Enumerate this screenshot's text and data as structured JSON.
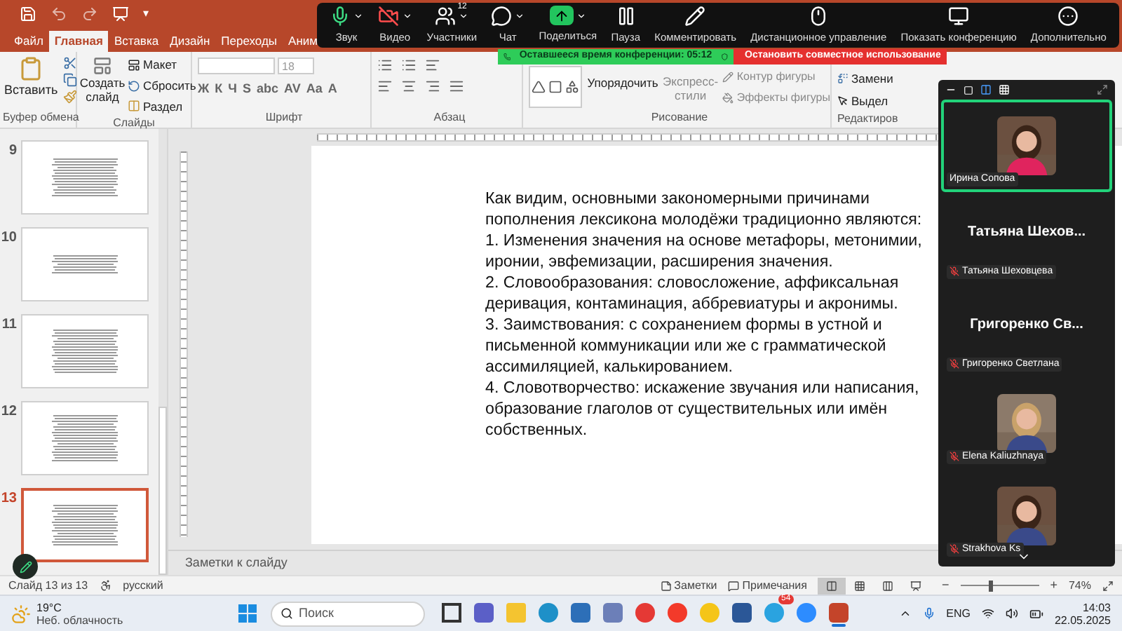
{
  "quick_access": {
    "dropdown": "▾"
  },
  "tabs": [
    {
      "label": "Файл",
      "selected": false
    },
    {
      "label": "Главная",
      "selected": true
    },
    {
      "label": "Вставка",
      "selected": false
    },
    {
      "label": "Дизайн",
      "selected": false
    },
    {
      "label": "Переходы",
      "selected": false
    },
    {
      "label": "Аним",
      "selected": false
    }
  ],
  "ribbon": {
    "clipboard": {
      "paste": "Вставить",
      "label": "Буфер обмена"
    },
    "slides": {
      "new_slide": "Создать слайд",
      "layout": "Макет",
      "reset": "Сбросить",
      "section": "Раздел",
      "label": "Слайды"
    },
    "font": {
      "size": "18",
      "buttons": [
        "Ж",
        "К",
        "Ч",
        "S",
        "abc",
        "AV",
        "Aa",
        "A"
      ],
      "label": "Шрифт"
    },
    "paragraph": {
      "label": "Абзац"
    },
    "drawing": {
      "arrange": "Упорядочить",
      "styles": "Экспресс-стили",
      "outline": "Контур фигуры",
      "effects": "Эффекты фигуры",
      "label": "Рисование"
    },
    "editing": {
      "replace": "Замени",
      "select": "Выдел",
      "label": "Редактиров"
    }
  },
  "thumbnails": [
    {
      "number": "9",
      "selected": false
    },
    {
      "number": "10",
      "selected": false
    },
    {
      "number": "11",
      "selected": false
    },
    {
      "number": "12",
      "selected": false
    },
    {
      "number": "13",
      "selected": true
    }
  ],
  "slide": {
    "paragraphs": [
      "Как видим, основными закономерными причинами пополнения лексикона молодёжи традиционно являются:",
      "1. Изменения значения на основе метафоры, метонимии, иронии, эвфемизации, расширения значения.",
      "2. Словообразования: словосложение, аффиксальная деривация, контаминация, аббревиатуры и акронимы.",
      "3. Заимствования: с сохранением формы в устной и письменной коммуникации или же с грамматической ассимиляцией, калькированием.",
      "4. Словотворчество: искажение звучания или написания, образование глаголов от существительных или имён собственных."
    ]
  },
  "notes": {
    "placeholder": "Заметки к слайду"
  },
  "status_bar": {
    "slide": "Слайд 13 из 13",
    "language": "русский",
    "notes": "Заметки",
    "comments": "Примечания",
    "views": [
      {
        "selected": true
      },
      {
        "selected": false
      },
      {
        "selected": false
      },
      {
        "selected": false
      }
    ],
    "zoom_minus": "−",
    "zoom_plus": "+",
    "zoom": {
      "level": 0.38
    },
    "zoom_percent": "74%"
  },
  "meeting_toolbar": [
    {
      "kind": "mic",
      "label": "Звук",
      "caret": true
    },
    {
      "kind": "video",
      "label": "Видео",
      "caret": true
    },
    {
      "kind": "participants",
      "label": "Участники",
      "badge": "12",
      "caret": true
    },
    {
      "kind": "chat",
      "label": "Чат",
      "caret": true
    },
    {
      "kind": "share",
      "label": "Поделиться",
      "caret": true
    },
    {
      "kind": "pause",
      "label": "Пауза",
      "caret": false
    },
    {
      "kind": "annotate",
      "label": "Комментировать",
      "caret": false
    },
    {
      "kind": "remote",
      "label": "Дистанционное управление",
      "caret": false
    },
    {
      "kind": "view",
      "label": "Показать конференцию",
      "caret": false
    },
    {
      "kind": "more",
      "label": "Дополнительно",
      "caret": false
    }
  ],
  "meeting_banner": {
    "timer": "Оставшееся время конференции: 05:12",
    "stop": "Остановить совместное использование"
  },
  "participants": [
    {
      "kind": "video",
      "name": "Ирина Сопова",
      "muted": false,
      "active": true
    },
    {
      "kind": "name",
      "title": "Татьяна Шехов...",
      "name": "Татьяна Шеховцева",
      "muted": true,
      "active": false
    },
    {
      "kind": "name",
      "title": "Григоренко Св...",
      "name": "Григоренко Светлана",
      "muted": true,
      "active": false
    },
    {
      "kind": "video",
      "name": "Elena Kaliuzhnaya",
      "muted": true,
      "active": false
    },
    {
      "kind": "video",
      "name": "Strakhova Ks",
      "muted": true,
      "active": false
    }
  ],
  "taskbar": {
    "weather": {
      "temp": "19°C",
      "text": "Неб. облачность"
    },
    "search": {
      "placeholder": "Поиск"
    },
    "apps": [
      {
        "kind": "taskview",
        "color": "#333333",
        "active": false
      },
      {
        "kind": "square",
        "color": "#5b5fc7",
        "active": false
      },
      {
        "kind": "folder",
        "color": "#f4c430",
        "active": false
      },
      {
        "kind": "circle",
        "color": "#1e90c8",
        "active": false
      },
      {
        "kind": "square",
        "color": "#2d6fb8",
        "active": false
      },
      {
        "kind": "square",
        "color": "#6c7fb8",
        "active": false
      },
      {
        "kind": "circle",
        "color": "#e53935",
        "active": false
      },
      {
        "kind": "circle",
        "color": "#f33a2a",
        "active": false
      },
      {
        "kind": "circle",
        "color": "#f5c518",
        "active": false
      },
      {
        "kind": "square",
        "color": "#2b5797",
        "active": false
      },
      {
        "kind": "circle",
        "color": "#2aa3e0",
        "badge": "54",
        "active": false
      },
      {
        "kind": "circle",
        "color": "#2d8cff",
        "active": false
      },
      {
        "kind": "square",
        "color": "#c4442a",
        "active": true
      }
    ],
    "language": "ENG",
    "time": "14:03",
    "date": "22.05.2025"
  }
}
